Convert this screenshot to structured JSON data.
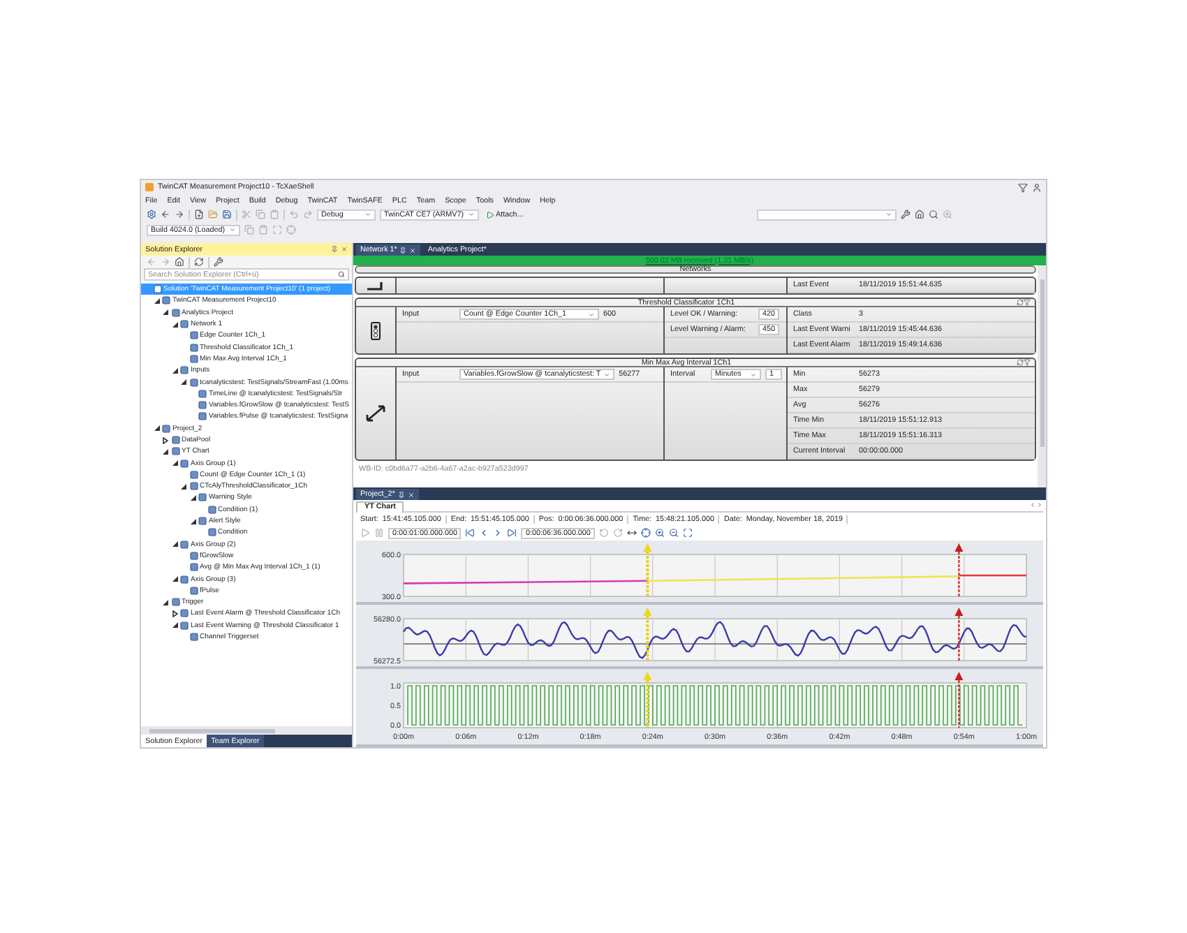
{
  "window": {
    "title": "TwinCAT Measurement Project10 - TcXaeShell"
  },
  "menu": [
    "File",
    "Edit",
    "View",
    "Project",
    "Build",
    "Debug",
    "TwinCAT",
    "TwinSAFE",
    "PLC",
    "Team",
    "Scope",
    "Tools",
    "Window",
    "Help"
  ],
  "toolbar": {
    "configuration": "Debug",
    "platform": "TwinCAT CE7 (ARMV7)",
    "attach": "Attach...",
    "build": "Build 4024.0 (Loaded)"
  },
  "solution_explorer": {
    "title": "Solution Explorer",
    "search": {
      "placeholder": "Search Solution Explorer (Ctrl+ü)"
    },
    "tree": [
      {
        "label": "Solution 'TwinCAT Measurement Project10' (1 project)",
        "selected": true,
        "children": [
          {
            "label": "TwinCAT Measurement Project10",
            "selected": false,
            "expanded": true,
            "children": [
              {
                "label": "Analytics Project",
                "selected": false,
                "expanded": true,
                "children": [
                  {
                    "label": "Network 1",
                    "selected": false,
                    "expanded": true,
                    "children": [
                      {
                        "label": "Edge Counter 1Ch_1",
                        "selected": false
                      },
                      {
                        "label": "Threshold Classificator 1Ch_1",
                        "selected": false
                      },
                      {
                        "label": "Min Max Avg Interval 1Ch_1",
                        "selected": false
                      }
                    ]
                  },
                  {
                    "label": "Inputs",
                    "selected": false,
                    "expanded": true,
                    "children": [
                      {
                        "label": "tcanalyticstest: TestSignals/StreamFast (1.00ms",
                        "selected": false,
                        "expanded": true,
                        "children": [
                          {
                            "label": "TimeLine @ tcanalyticstest: TestSignals/Str",
                            "selected": false
                          },
                          {
                            "label": "Variables.fGrowSlow @ tcanalyticstest: TestS",
                            "selected": false
                          },
                          {
                            "label": "Variables.fPulse @ tcanalyticstest: TestSigna",
                            "selected": false
                          }
                        ]
                      }
                    ]
                  }
                ]
              }
            ]
          },
          {
            "label": "Project_2",
            "selected": false,
            "expanded": true,
            "children": [
              {
                "label": "DataPool",
                "selected": false,
                "expanded": false
              },
              {
                "label": "YT Chart",
                "selected": false,
                "expanded": true,
                "children": [
                  {
                    "label": "Axis Group (1)",
                    "selected": false,
                    "expanded": true,
                    "children": [
                      {
                        "label": "Count @ Edge Counter 1Ch_1 (1)",
                        "selected": false
                      },
                      {
                        "label": "CTcAlyThresholdClassificator_1Ch",
                        "selected": false,
                        "expanded": true,
                        "children": [
                          {
                            "label": "Warning Style",
                            "selected": false,
                            "expanded": true,
                            "children": [
                              {
                                "label": "Condition (1)",
                                "selected": false
                              }
                            ]
                          },
                          {
                            "label": "Alert Style",
                            "selected": false,
                            "expanded": true,
                            "children": [
                              {
                                "label": "Condition",
                                "selected": false
                              }
                            ]
                          }
                        ]
                      }
                    ]
                  },
                  {
                    "label": "Axis Group (2)",
                    "selected": false,
                    "expanded": true,
                    "children": [
                      {
                        "label": "fGrowSlow",
                        "selected": false
                      },
                      {
                        "label": "Avg @ Min Max Avg Interval 1Ch_1 (1)",
                        "selected": false
                      }
                    ]
                  },
                  {
                    "label": "Axis Group (3)",
                    "selected": false,
                    "expanded": true,
                    "children": [
                      {
                        "label": "fPulse",
                        "selected": false
                      }
                    ]
                  }
                ]
              },
              {
                "label": "Trigger",
                "selected": false,
                "expanded": true,
                "children": [
                  {
                    "label": "Last Event Alarm @ Threshold Classificator 1Ch",
                    "selected": false,
                    "expanded": false
                  },
                  {
                    "label": "Last Event Warning @ Threshold Classificator 1",
                    "selected": false,
                    "expanded": true,
                    "children": [
                      {
                        "label": "Channel Triggerset",
                        "selected": false
                      }
                    ]
                  }
                ]
              }
            ]
          }
        ]
      }
    ],
    "tabs": [
      {
        "label": "Solution Explorer",
        "selected": true
      },
      {
        "label": "Team Explorer",
        "selected": false
      }
    ]
  },
  "document_tabs": [
    {
      "label": "Network 1*",
      "selected": true
    },
    {
      "label": "Analytics Project*",
      "selected": false
    }
  ],
  "status": "500.02 MB received (1.31 MB/s)",
  "networks": {
    "title": "Networks",
    "blocks": [
      {
        "kind": "counter",
        "outputs": [
          {
            "label": "Last Event",
            "value": "18/11/2019 15:51:44.635"
          }
        ]
      },
      {
        "kind": "threshold",
        "title": "Threshold Classificator 1Ch1",
        "inputs": [
          {
            "label": "Input",
            "source": "Count @ Edge Counter 1Ch_1",
            "value": "600"
          }
        ],
        "settings": [
          {
            "label": "Level OK / Warning:",
            "value": "420"
          },
          {
            "label": "Level Warning / Alarm:",
            "value": "450"
          }
        ],
        "outputs": [
          {
            "label": "Class",
            "value": "3"
          },
          {
            "label": "Last Event Warni",
            "value": "18/11/2019 15:45:44.636"
          },
          {
            "label": "Last Event Alarm",
            "value": "18/11/2019 15:49:14.636"
          }
        ]
      },
      {
        "kind": "minmax",
        "title": "Min Max Avg Interval 1Ch1",
        "inputs": [
          {
            "label": "Input",
            "source": "Variables.fGrowSlow @ tcanalyticstest: T",
            "value": "56277"
          }
        ],
        "settings": [
          {
            "label": "Interval",
            "unit": "Minutes",
            "value": "1"
          }
        ],
        "outputs": [
          {
            "label": "Min",
            "value": "56273"
          },
          {
            "label": "Max",
            "value": "56279"
          },
          {
            "label": "Avg",
            "value": "56276"
          },
          {
            "label": "Time Min",
            "value": "18/11/2019 15:51:12.913"
          },
          {
            "label": "Time Max",
            "value": "18/11/2019 15:51:16.313"
          },
          {
            "label": "Current Interval",
            "value": "00:00:00.000"
          }
        ]
      }
    ],
    "footer": "WB-ID: c0bd6a77-a2b6-4a67-a2ac-b927a523d997"
  },
  "chart_window": {
    "tab": "Project_2*",
    "view_tab": "YT Chart",
    "info": [
      {
        "label": "Start:",
        "value": "15:41:45.105.000"
      },
      {
        "label": "End:",
        "value": "15:51:45.105.000"
      },
      {
        "label": "Pos:",
        "value": "0:00:06:36.000.000"
      },
      {
        "label": "Time:",
        "value": "15:48:21.105.000"
      },
      {
        "label": "Date:",
        "value": "Monday, November 18, 2019"
      }
    ],
    "range_field": "0:00:01:00.000.000",
    "position_field": "0:00:06:36.000.000",
    "trend_labels": [
      "600.0",
      "300.0"
    ],
    "wave_labels": [
      "56280.0",
      "56272.5"
    ],
    "pulse_labels": [
      "1.0",
      "0.5",
      "0.0"
    ],
    "time_axis": [
      "0:00m",
      "0:06m",
      "0:12m",
      "0:18m",
      "0:24m",
      "0:30m",
      "0:36m",
      "0:42m",
      "0:48m",
      "0:54m",
      "1:00m"
    ]
  }
}
